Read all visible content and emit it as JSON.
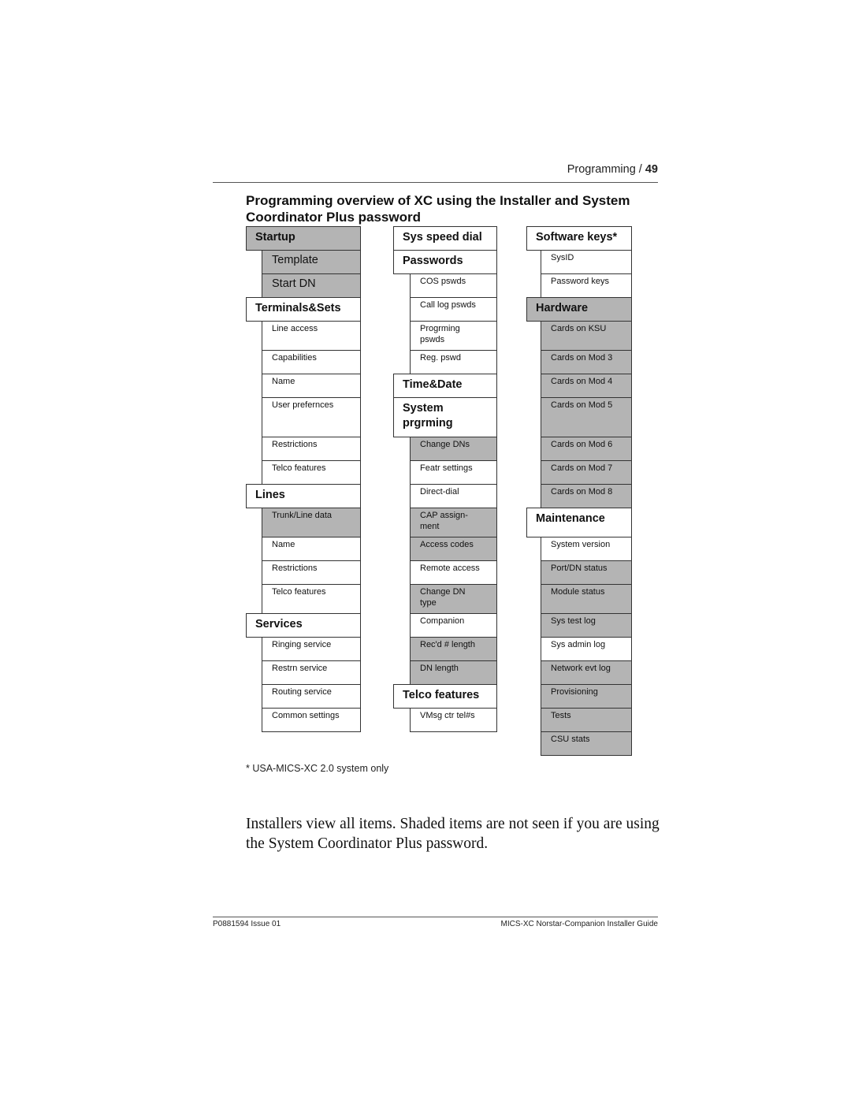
{
  "running_head": {
    "section": "Programming",
    "separator": " / ",
    "page_number": "49"
  },
  "title": "Programming overview of XC using the Installer and System Coordinator Plus password",
  "colors": {
    "shaded": "#b4b4b4",
    "unshaded": "#ffffff",
    "border": "#333333"
  },
  "columns": [
    {
      "name": "left",
      "items": [
        {
          "label": "Startup",
          "type": "header",
          "shaded": true
        },
        {
          "label": "Template",
          "type": "big",
          "shaded": true
        },
        {
          "label": "Start DN",
          "type": "big",
          "shaded": true
        },
        {
          "label": "Terminals&Sets",
          "type": "header",
          "shaded": false
        },
        {
          "label": "Line access",
          "type": "sub",
          "shaded": false
        },
        {
          "label": "Capabilities",
          "type": "sub",
          "shaded": false
        },
        {
          "label": "Name",
          "type": "sub",
          "shaded": false
        },
        {
          "label": "User prefernces",
          "type": "sub",
          "shaded": false
        },
        {
          "label": "Restrictions",
          "type": "sub",
          "shaded": false
        },
        {
          "label": "Telco features",
          "type": "sub",
          "shaded": false
        },
        {
          "label": "Lines",
          "type": "header",
          "shaded": false
        },
        {
          "label": "Trunk/Line data",
          "type": "sub",
          "shaded": true
        },
        {
          "label": "Name",
          "type": "sub",
          "shaded": false
        },
        {
          "label": "Restrictions",
          "type": "sub",
          "shaded": false
        },
        {
          "label": "Telco features",
          "type": "sub",
          "shaded": false
        },
        {
          "label": "Services",
          "type": "header",
          "shaded": false
        },
        {
          "label": "Ringing service",
          "type": "sub",
          "shaded": false
        },
        {
          "label": "Restrn service",
          "type": "sub",
          "shaded": false
        },
        {
          "label": "Routing service",
          "type": "sub",
          "shaded": false
        },
        {
          "label": "Common settings",
          "type": "sub",
          "shaded": false
        }
      ]
    },
    {
      "name": "middle",
      "items": [
        {
          "label": "Sys speed dial",
          "type": "header",
          "shaded": false
        },
        {
          "label": "Passwords",
          "type": "header",
          "shaded": false
        },
        {
          "label": "COS pswds",
          "type": "sub",
          "shaded": false
        },
        {
          "label": "Call log pswds",
          "type": "sub",
          "shaded": false
        },
        {
          "label": "Progrming\npswds",
          "type": "sub",
          "shaded": false
        },
        {
          "label": "Reg. pswd",
          "type": "sub",
          "shaded": false
        },
        {
          "label": "Time&Date",
          "type": "header",
          "shaded": false
        },
        {
          "label": "System\nprgrming",
          "type": "header",
          "shaded": false
        },
        {
          "label": "Change DNs",
          "type": "sub",
          "shaded": true
        },
        {
          "label": "Featr settings",
          "type": "sub",
          "shaded": false
        },
        {
          "label": "Direct-dial",
          "type": "sub",
          "shaded": false
        },
        {
          "label": "CAP assign-\nment",
          "type": "sub",
          "shaded": true
        },
        {
          "label": "Access codes",
          "type": "sub",
          "shaded": true
        },
        {
          "label": "Remote access",
          "type": "sub",
          "shaded": false
        },
        {
          "label": "Change DN\ntype",
          "type": "sub",
          "shaded": true
        },
        {
          "label": "Companion",
          "type": "sub",
          "shaded": false
        },
        {
          "label": "Rec'd # length",
          "type": "sub",
          "shaded": true
        },
        {
          "label": "DN length",
          "type": "sub",
          "shaded": true
        },
        {
          "label": "Telco features",
          "type": "header",
          "shaded": false
        },
        {
          "label": "VMsg ctr tel#s",
          "type": "sub",
          "shaded": false
        }
      ]
    },
    {
      "name": "right",
      "items": [
        {
          "label": "Software keys*",
          "type": "header",
          "shaded": false
        },
        {
          "label": "SysID",
          "type": "sub",
          "shaded": false
        },
        {
          "label": "Password keys",
          "type": "sub",
          "shaded": false
        },
        {
          "label": "Hardware",
          "type": "header",
          "shaded": true
        },
        {
          "label": "Cards on KSU",
          "type": "sub",
          "shaded": true
        },
        {
          "label": "Cards on Mod 3",
          "type": "sub",
          "shaded": true
        },
        {
          "label": "Cards on Mod 4",
          "type": "sub",
          "shaded": true
        },
        {
          "label": "Cards on Mod 5",
          "type": "sub",
          "shaded": true
        },
        {
          "label": "Cards on Mod 6",
          "type": "sub",
          "shaded": true
        },
        {
          "label": "Cards on Mod 7",
          "type": "sub",
          "shaded": true
        },
        {
          "label": "Cards on Mod 8",
          "type": "sub",
          "shaded": true
        },
        {
          "label": "Maintenance",
          "type": "header",
          "shaded": false
        },
        {
          "label": "System version",
          "type": "sub",
          "shaded": false
        },
        {
          "label": "Port/DN status",
          "type": "sub",
          "shaded": true
        },
        {
          "label": "Module status",
          "type": "sub",
          "shaded": true
        },
        {
          "label": "Sys test log",
          "type": "sub",
          "shaded": true
        },
        {
          "label": "Sys admin log",
          "type": "sub",
          "shaded": false
        },
        {
          "label": "Network evt log",
          "type": "sub",
          "shaded": true
        },
        {
          "label": "Provisioning",
          "type": "sub",
          "shaded": true
        },
        {
          "label": "Tests",
          "type": "sub",
          "shaded": true
        },
        {
          "label": "CSU stats",
          "type": "sub",
          "shaded": true
        }
      ]
    }
  ],
  "footnote": "* USA-MICS-XC 2.0 system only",
  "body_text": "Installers view all items. Shaded items are not seen if you are using the System Coordinator Plus password.",
  "footer": {
    "left": "P0881594 Issue 01",
    "right": "MICS-XC Norstar-Companion Installer Guide"
  }
}
